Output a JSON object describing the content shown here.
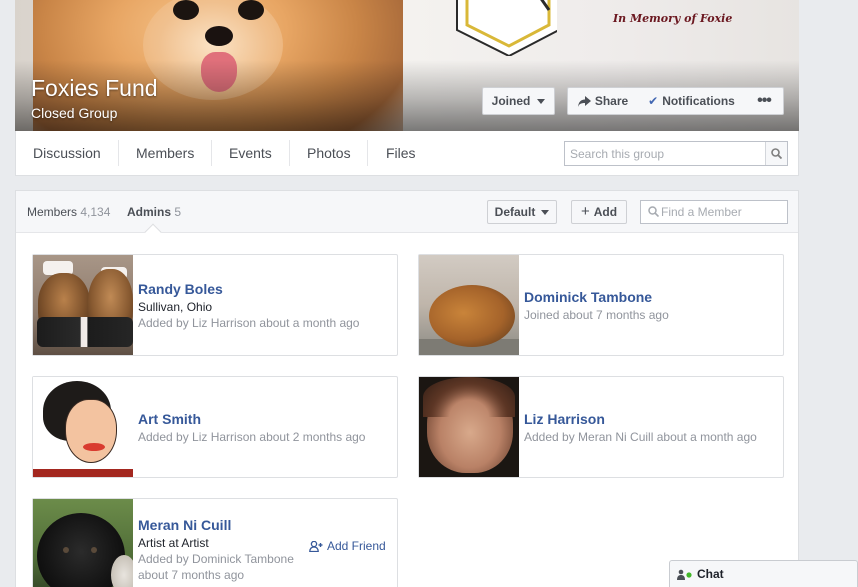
{
  "cover": {
    "memory_text": "In Memory of Foxie",
    "group_name": "Foxies Fund",
    "group_type": "Closed Group",
    "joined_label": "Joined",
    "share_label": "Share",
    "notifications_label": "Notifications",
    "more_label": "•••"
  },
  "nav": {
    "tabs": [
      "Discussion",
      "Members",
      "Events",
      "Photos",
      "Files"
    ],
    "search_placeholder": "Search this group"
  },
  "members_panel": {
    "members_label": "Members",
    "members_count": "4,134",
    "admins_label": "Admins",
    "admins_count": "5",
    "sort_label": "Default",
    "add_label": "Add",
    "find_placeholder": "Find a Member"
  },
  "admins": [
    {
      "name": "Randy Boles",
      "detail": "Sullivan, Ohio",
      "added": "Added by Liz Harrison about a month ago"
    },
    {
      "name": "Dominick Tambone",
      "added": "Joined about 7 months ago"
    },
    {
      "name": "Art Smith",
      "added": "Added by Liz Harrison about 2 months ago"
    },
    {
      "name": "Liz Harrison",
      "added": "Added by Meran Ni Cuill about a month ago"
    },
    {
      "name": "Meran Ni Cuill",
      "detail": "Artist at Artist",
      "added_line1": "Added by Dominick Tambone",
      "added_line2": "about 7 months ago",
      "add_friend_label": "Add Friend"
    }
  ],
  "chat": {
    "label": "Chat"
  },
  "colors": {
    "link": "#365899",
    "background": "#e9ebee",
    "accent": "#4267b2"
  }
}
